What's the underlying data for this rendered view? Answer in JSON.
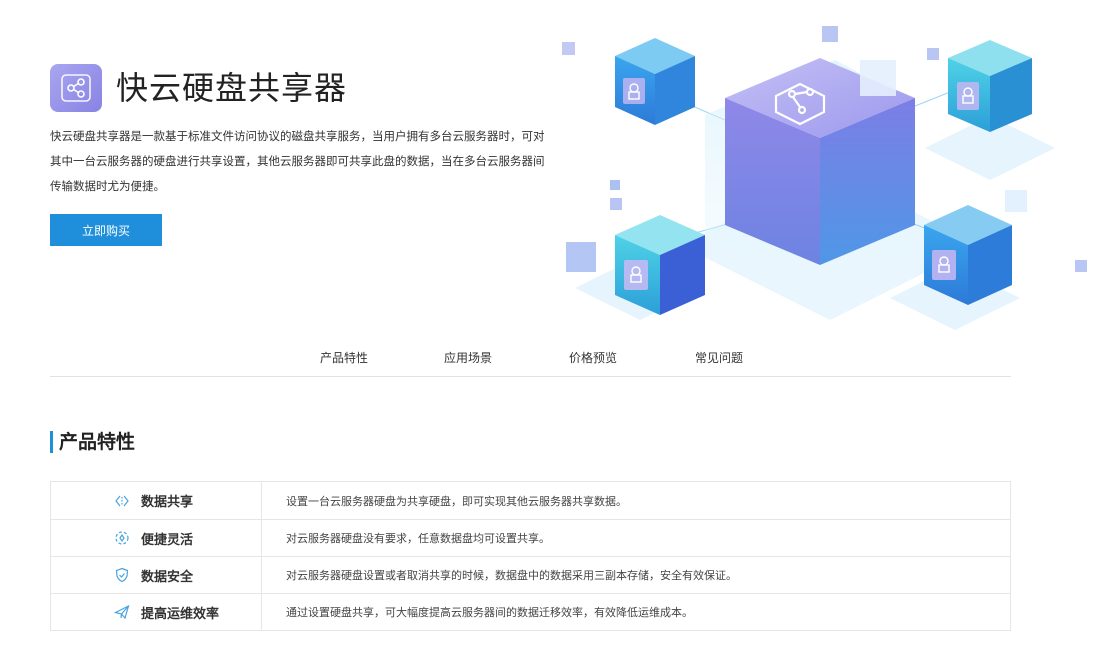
{
  "hero": {
    "title": "快云硬盘共享器",
    "description": "快云硬盘共享器是一款基于标准文件访问协议的磁盘共享服务，当用户拥有多台云服务器时，可对其中一台云服务器的硬盘进行共享设置，其他云服务器即可共享此盘的数据，当在多台云服务器间传输数据时尤为便捷。",
    "buy_button": "立即购买",
    "logo_icon": "share-icon",
    "accent_color": "#1f8fdb",
    "logo_color": "#9b97ea"
  },
  "nav": {
    "items": [
      "产品特性",
      "应用场景",
      "价格预览",
      "常见问题"
    ]
  },
  "features": {
    "heading": "产品特性",
    "rows": [
      {
        "icon": "data-share-icon",
        "name": "数据共享",
        "desc": "设置一台云服务器硬盘为共享硬盘，即可实现其他云服务器共享数据。"
      },
      {
        "icon": "flexible-icon",
        "name": "便捷灵活",
        "desc": "对云服务器硬盘没有要求，任意数据盘均可设置共享。"
      },
      {
        "icon": "shield-icon",
        "name": "数据安全",
        "desc": "对云服务器硬盘设置或者取消共享的时候，数据盘中的数据采用三副本存储，安全有效保证。"
      },
      {
        "icon": "paper-plane-icon",
        "name": "提高运维效率",
        "desc": "通过设置硬盘共享，可大幅度提高云服务器间的数据迁移效率，有效降低运维成本。"
      }
    ]
  }
}
